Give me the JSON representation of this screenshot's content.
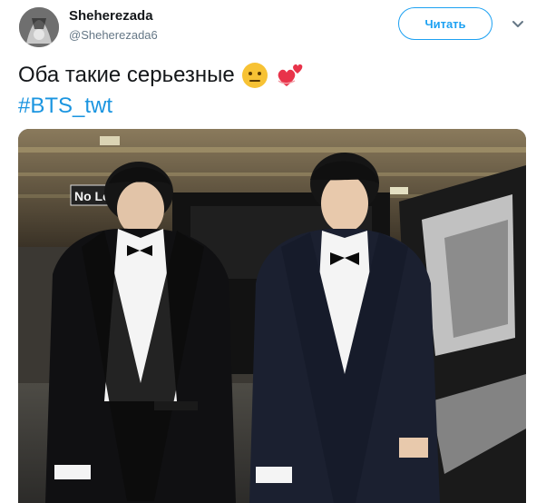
{
  "author": {
    "display_name": "Sheherezada",
    "screen_name": "@Sheherezada6",
    "avatar_icon": "avatar-image"
  },
  "header": {
    "follow_label": "Читать",
    "menu_icon": "chevron-down-icon"
  },
  "tweet": {
    "text": "Оба такие серьезные",
    "emojis": [
      "neutral-face-emoji",
      "two-hearts-emoji"
    ],
    "hashtag": "#BTS_twt"
  },
  "media": {
    "sign_text": "No Le"
  },
  "colors": {
    "accent": "#1da1f2",
    "hashtag": "#1b95e0",
    "text": "#14171a",
    "muted": "#657786"
  }
}
